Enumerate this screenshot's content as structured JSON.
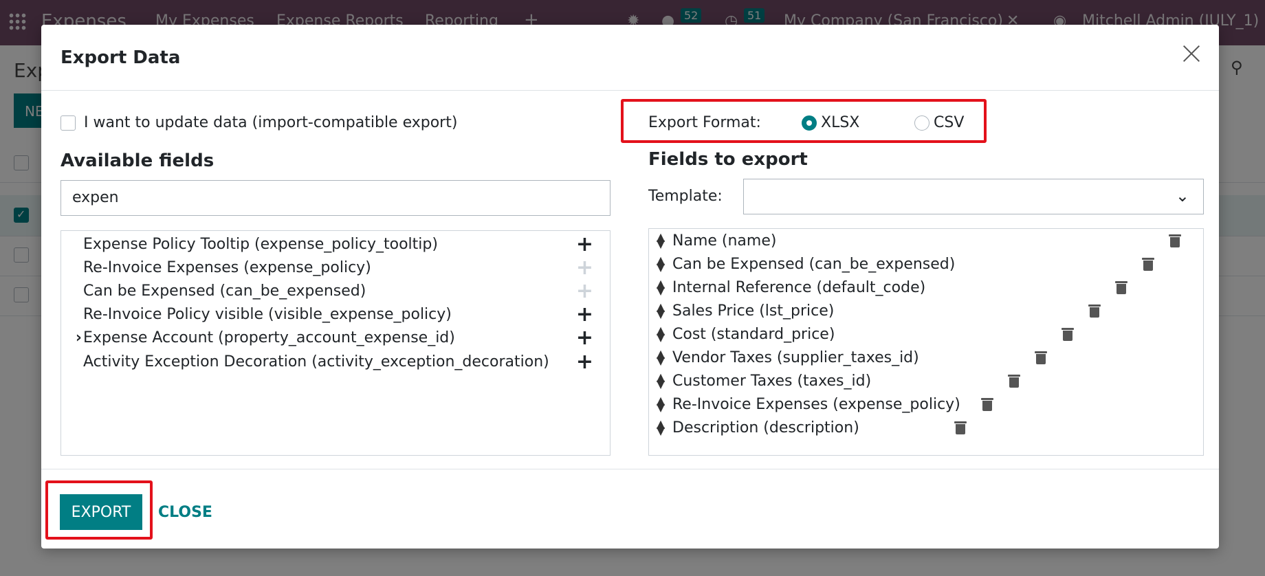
{
  "topbar": {
    "app_name": "Expenses",
    "menu": [
      "My Expenses",
      "Expense Reports",
      "Reporting",
      "+"
    ],
    "messages_badge": "52",
    "activities_badge": "51",
    "company": "My Company (San Francisco)",
    "user": "Mitchell Admin (JULY_1)"
  },
  "background": {
    "page_title": "Exp",
    "new_button": "NE"
  },
  "dialog": {
    "title": "Export Data",
    "import_compatible_label": "I want to update data (import-compatible export)",
    "available_fields_heading": "Available fields",
    "search_value": "expen",
    "available_fields": [
      {
        "label": "Expense Policy Tooltip (expense_policy_tooltip)",
        "expandable": false,
        "added": false
      },
      {
        "label": "Re-Invoice Expenses (expense_policy)",
        "expandable": false,
        "added": true
      },
      {
        "label": "Can be Expensed (can_be_expensed)",
        "expandable": false,
        "added": true
      },
      {
        "label": "Re-Invoice Policy visible (visible_expense_policy)",
        "expandable": false,
        "added": false
      },
      {
        "label": "Expense Account (property_account_expense_id)",
        "expandable": true,
        "added": false
      },
      {
        "label": "Activity Exception Decoration (activity_exception_decoration)",
        "expandable": false,
        "added": false
      }
    ],
    "export_format_label": "Export Format:",
    "formats": [
      {
        "label": "XLSX",
        "selected": true
      },
      {
        "label": "CSV",
        "selected": false
      }
    ],
    "fields_to_export_heading": "Fields to export",
    "template_label": "Template:",
    "template_value": "",
    "fields_to_export": [
      "Name (name)",
      "Can be Expensed (can_be_expensed)",
      "Internal Reference (default_code)",
      "Sales Price (lst_price)",
      "Cost (standard_price)",
      "Vendor Taxes (supplier_taxes_id)",
      "Customer Taxes (taxes_id)",
      "Re-Invoice Expenses (expense_policy)",
      "Description (description)"
    ],
    "export_button": "EXPORT",
    "close_button": "CLOSE"
  },
  "colors": {
    "primary": "#017e84",
    "navbar": "#714b67",
    "highlight": "#e3111b"
  }
}
